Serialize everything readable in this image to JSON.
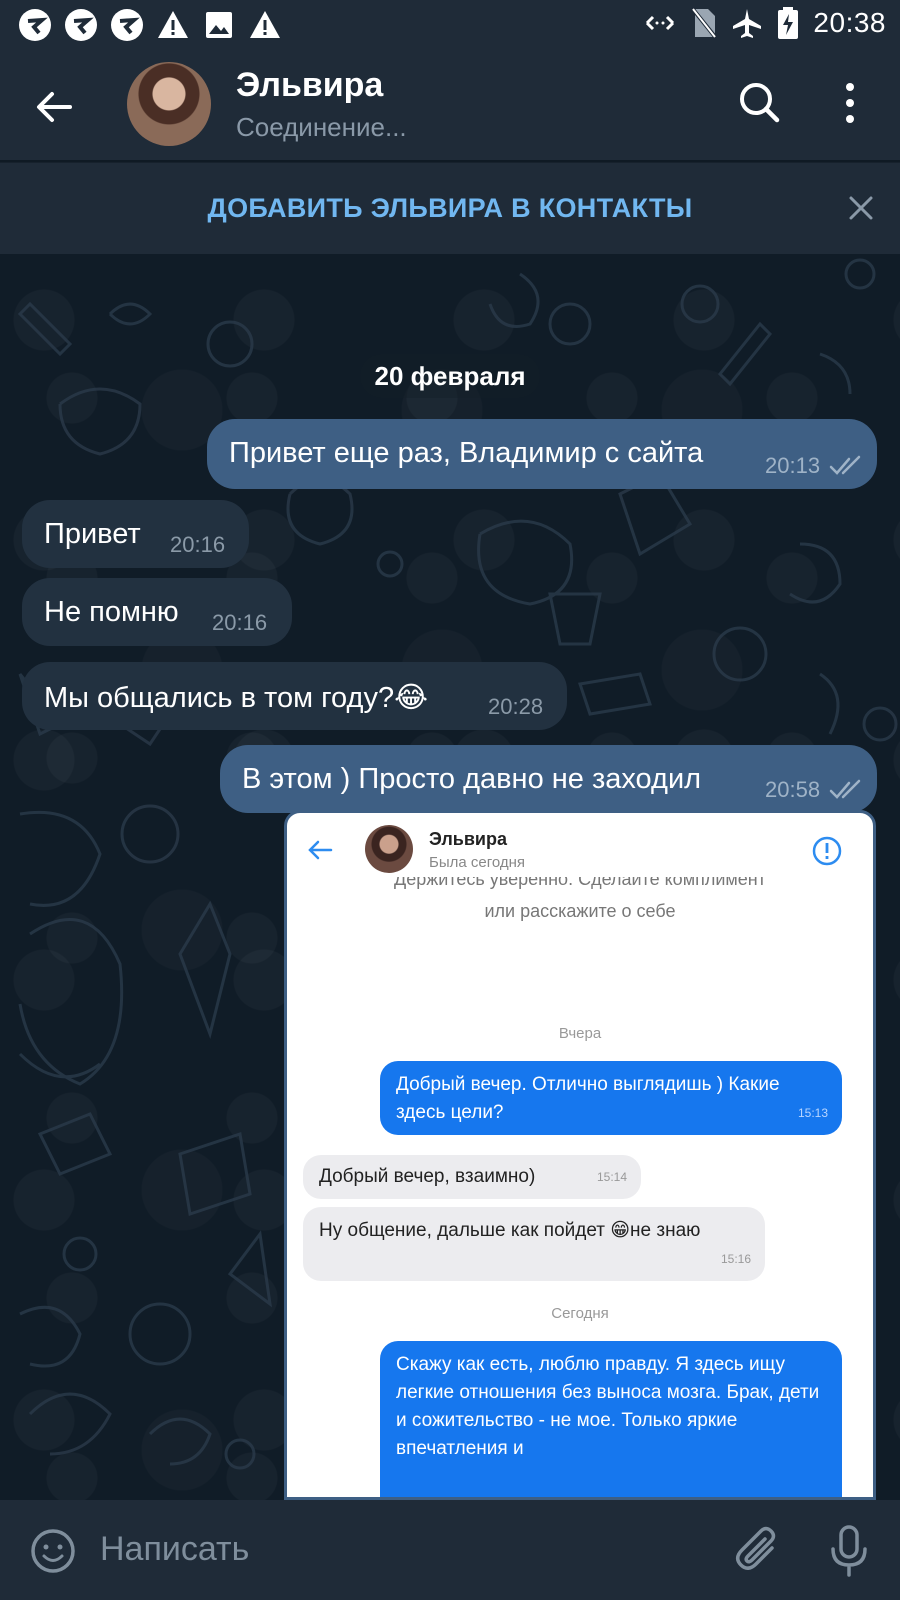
{
  "status_bar": {
    "time": "20:38",
    "left_icons": [
      "app-notification-icon",
      "app-notification-icon",
      "app-notification-icon",
      "warning-icon",
      "image-icon",
      "warning-icon"
    ],
    "right_icons": [
      "data-arrows-icon",
      "no-sim-icon",
      "airplane-icon",
      "battery-charging-icon"
    ]
  },
  "header": {
    "contact_name": "Эльвира",
    "connection_status": "Соединение..."
  },
  "banner": {
    "add_contact_label": "ДОБАВИТЬ ЭЛЬВИРА В КОНТАКТЫ"
  },
  "chat": {
    "date_separator": "20 февраля",
    "messages": [
      {
        "direction": "out",
        "text": "Привет еще раз, Владимир с сайта",
        "time": "20:13",
        "read": true
      },
      {
        "direction": "in",
        "text": "Привет",
        "time": "20:16"
      },
      {
        "direction": "in",
        "text": "Не помню",
        "time": "20:16"
      },
      {
        "direction": "in",
        "text": "Мы общались в том году?😂",
        "time": "20:28"
      },
      {
        "direction": "out",
        "text": "В этом ) Просто давно не заходил",
        "time": "20:58",
        "read": true
      }
    ]
  },
  "screenshot_message": {
    "header_name": "Эльвира",
    "header_status": "Была сегодня",
    "cut_text_line1": "Держитесь уверенно. Сделайте комплимент",
    "cut_text_line2": "или расскажите о себе",
    "date_yesterday": "Вчера",
    "date_today": "Сегодня",
    "messages": [
      {
        "direction": "out",
        "text": "Добрый вечер. Отлично выглядишь ) Какие здесь цели?",
        "time": "15:13"
      },
      {
        "direction": "in",
        "text": "Добрый вечер, взаимно)",
        "time": "15:14"
      },
      {
        "direction": "in",
        "text": "Ну общение, дальше как пойдет 😁не знаю",
        "time": "15:16"
      },
      {
        "direction": "out",
        "text": "Скажу как есть, люблю правду. Я здесь ищу легкие отношения без выноса мозга. Брак, дети и сожительство - не мое. Только яркие впечатления и"
      }
    ]
  },
  "input_bar": {
    "placeholder": "Написать"
  },
  "colors": {
    "header_bg": "#1f2b38",
    "outgoing_bubble": "#3e5f84",
    "incoming_bubble": "#223140",
    "accent": "#71b7f0"
  }
}
